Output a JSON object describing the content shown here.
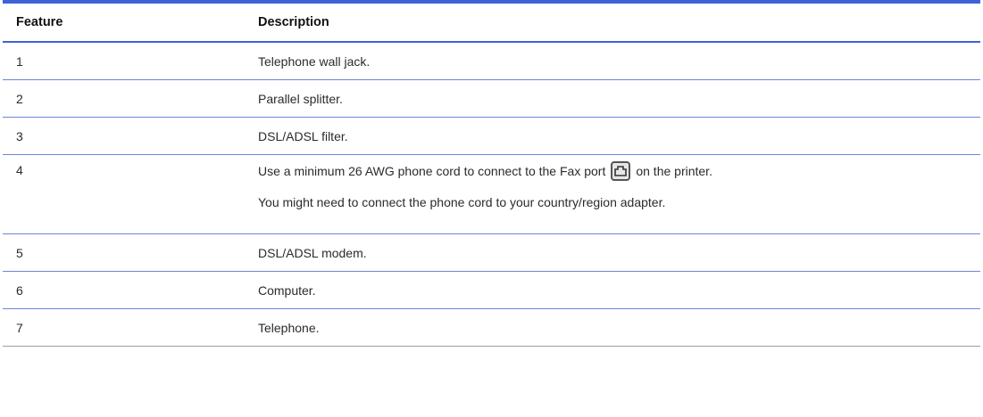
{
  "table": {
    "headers": {
      "feature": "Feature",
      "description": "Description"
    },
    "rows": [
      {
        "feature": "1",
        "description": "Telephone wall jack."
      },
      {
        "feature": "2",
        "description": "Parallel splitter."
      },
      {
        "feature": "3",
        "description": "DSL/ADSL filter."
      },
      {
        "feature": "4",
        "description_before_icon": "Use a minimum 26 AWG phone cord to connect to the Fax port",
        "description_after_icon": "on the printer.",
        "description_note": "You might need to connect the phone cord to your country/region adapter.",
        "icon": "fax-port-icon"
      },
      {
        "feature": "5",
        "description": "DSL/ADSL modem."
      },
      {
        "feature": "6",
        "description": "Computer."
      },
      {
        "feature": "7",
        "description": "Telephone."
      }
    ]
  },
  "colors": {
    "rule": "#3f63d6",
    "row_border": "#6c86d9",
    "last_border": "#9aa0a8"
  }
}
